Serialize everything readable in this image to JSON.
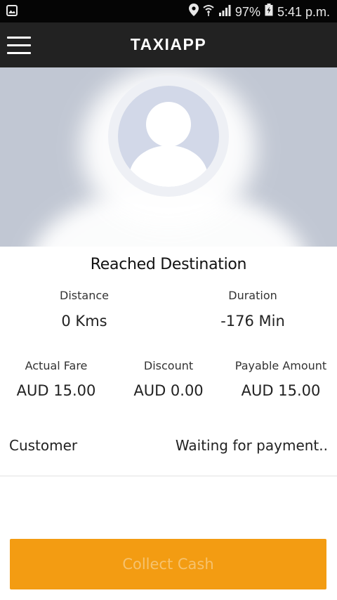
{
  "status_bar": {
    "battery": "97%",
    "time": "5:41 p.m."
  },
  "app_bar": {
    "title": "TAXIAPP"
  },
  "profile": {
    "name": "Customer"
  },
  "trip": {
    "status": "Reached Destination",
    "distance_label": "Distance",
    "distance_value": "0 Kms",
    "duration_label": "Duration",
    "duration_value": "-176 Min",
    "actual_fare_label": "Actual Fare",
    "actual_fare_value": "AUD 15.00",
    "discount_label": "Discount",
    "discount_value": "AUD 0.00",
    "payable_label": "Payable Amount",
    "payable_value": "AUD 15.00"
  },
  "payment": {
    "customer_label": "Customer",
    "status": "Waiting for payment.."
  },
  "actions": {
    "collect_label": "Collect Cash"
  },
  "colors": {
    "accent": "#f39c12",
    "app_bar": "#222222",
    "profile_bg": "#c1c7d3"
  }
}
